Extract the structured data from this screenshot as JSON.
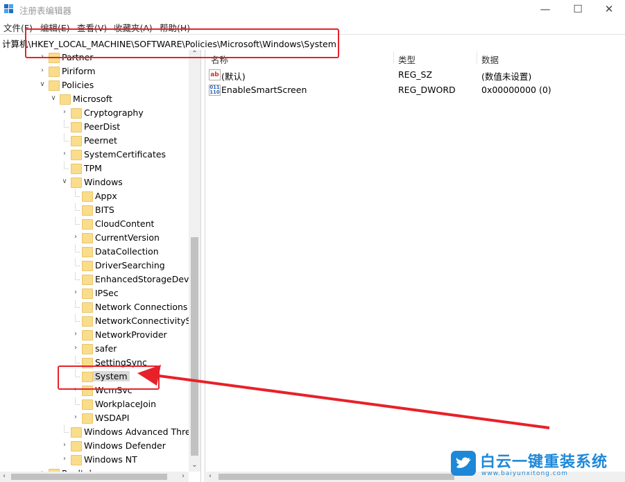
{
  "window": {
    "title": "注册表编辑器"
  },
  "menu": {
    "items": [
      "文件(F)",
      "编辑(E)",
      "查看(V)",
      "收藏夹(A)",
      "帮助(H)"
    ]
  },
  "address": {
    "path": "计算机\\HKEY_LOCAL_MACHINE\\SOFTWARE\\Policies\\Microsoft\\Windows\\System"
  },
  "tree": {
    "items": [
      {
        "label": "Partner",
        "expander": "collapsed"
      },
      {
        "label": "Piriform",
        "expander": "collapsed"
      },
      {
        "label": "Policies",
        "expander": "expanded"
      },
      {
        "label": "Microsoft",
        "expander": "expanded"
      },
      {
        "label": "Cryptography",
        "expander": "collapsed"
      },
      {
        "label": "PeerDist",
        "expander": "none"
      },
      {
        "label": "Peernet",
        "expander": "none"
      },
      {
        "label": "SystemCertificates",
        "expander": "collapsed"
      },
      {
        "label": "TPM",
        "expander": "none"
      },
      {
        "label": "Windows",
        "expander": "expanded"
      },
      {
        "label": "Appx",
        "expander": "none"
      },
      {
        "label": "BITS",
        "expander": "none"
      },
      {
        "label": "CloudContent",
        "expander": "none"
      },
      {
        "label": "CurrentVersion",
        "expander": "collapsed"
      },
      {
        "label": "DataCollection",
        "expander": "none"
      },
      {
        "label": "DriverSearching",
        "expander": "none"
      },
      {
        "label": "EnhancedStorageDevices",
        "expander": "none"
      },
      {
        "label": "IPSec",
        "expander": "collapsed"
      },
      {
        "label": "Network Connections",
        "expander": "none"
      },
      {
        "label": "NetworkConnectivityStatusIndicator",
        "expander": "none"
      },
      {
        "label": "NetworkProvider",
        "expander": "collapsed"
      },
      {
        "label": "safer",
        "expander": "collapsed"
      },
      {
        "label": "SettingSync",
        "expander": "none"
      },
      {
        "label": "System",
        "expander": "none",
        "selected": true
      },
      {
        "label": "WcmSvc",
        "expander": "collapsed"
      },
      {
        "label": "WorkplaceJoin",
        "expander": "none"
      },
      {
        "label": "WSDAPI",
        "expander": "collapsed"
      },
      {
        "label": "Windows Advanced Threat Protection",
        "expander": "none"
      },
      {
        "label": "Windows Defender",
        "expander": "collapsed"
      },
      {
        "label": "Windows NT",
        "expander": "collapsed"
      },
      {
        "label": "Realtek",
        "expander": "collapsed"
      }
    ]
  },
  "list": {
    "columns": [
      "名称",
      "类型",
      "数据"
    ],
    "rows": [
      {
        "icon": "string-value-icon",
        "name": "(默认)",
        "type": "REG_SZ",
        "data": "(数值未设置)"
      },
      {
        "icon": "binary-value-icon",
        "name": "EnableSmartScreen",
        "type": "REG_DWORD",
        "data": "0x00000000 (0)"
      }
    ]
  },
  "watermark": {
    "brand": "白云一键重装系统",
    "url": "www.baiyunxitong.com"
  },
  "colors": {
    "annotation": "#e7212a",
    "folder": "#fadd8b",
    "brand_blue": "#1e88d8"
  }
}
